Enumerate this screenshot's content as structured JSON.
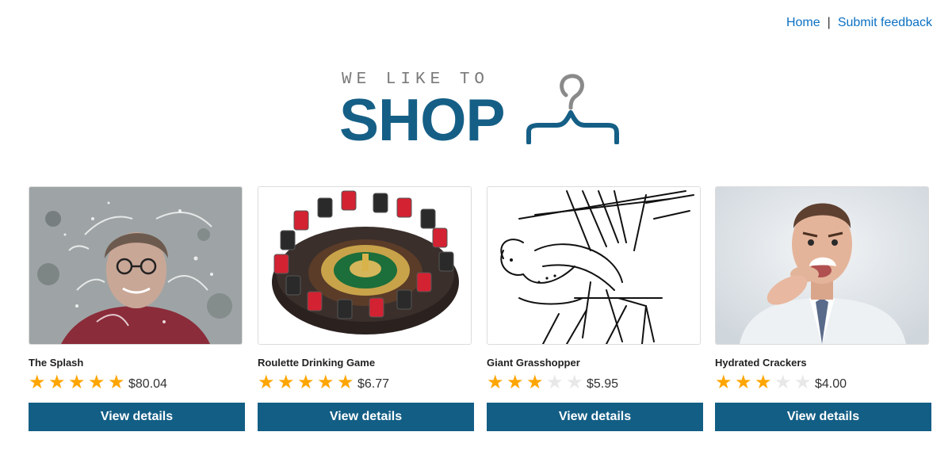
{
  "nav": {
    "home": "Home",
    "separator": "|",
    "feedback": "Submit feedback",
    "link_color": "#0c71c3"
  },
  "logo": {
    "tagline": "WE LIKE TO",
    "word": "SHOP",
    "icon": "hanger-icon",
    "brand_color": "#155f86"
  },
  "products": [
    {
      "name": "The Splash",
      "rating": 5,
      "price": "$80.04",
      "button": "View details",
      "image": "splash-photo"
    },
    {
      "name": "Roulette Drinking Game",
      "rating": 5,
      "price": "$6.77",
      "button": "View details",
      "image": "roulette-photo"
    },
    {
      "name": "Giant Grasshopper",
      "rating": 3,
      "price": "$5.95",
      "button": "View details",
      "image": "grasshopper-sketch"
    },
    {
      "name": "Hydrated Crackers",
      "rating": 3,
      "price": "$4.00",
      "button": "View details",
      "image": "crackers-photo"
    }
  ],
  "rating_max": 5,
  "colors": {
    "button": "#135e85",
    "star_filled": "#ffa500",
    "star_empty": "#e8e8e8"
  }
}
